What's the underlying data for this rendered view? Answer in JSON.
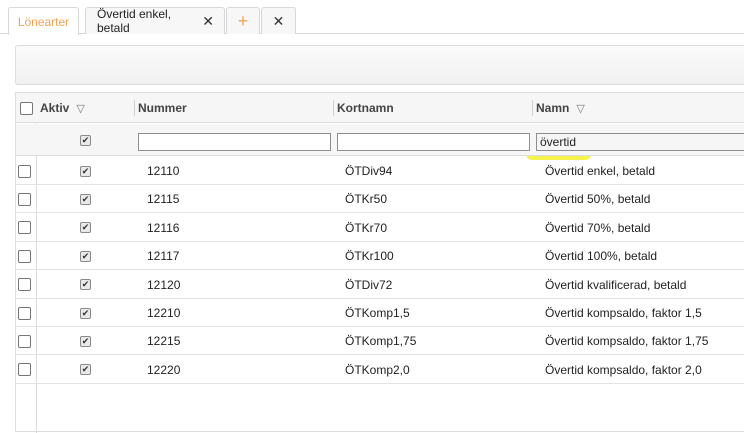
{
  "tabs": [
    {
      "label": "Lönearter",
      "active": true
    },
    {
      "label": "Övertid enkel, betald",
      "active": false
    }
  ],
  "tab_add_symbol": "+",
  "tab_close_symbol": "✕",
  "colors": {
    "accent": "#f0a45a",
    "highlight": "#f6f23a"
  },
  "grid": {
    "columns": [
      {
        "key": "aktiv",
        "label": "Aktiv",
        "filterable": true
      },
      {
        "key": "nummer",
        "label": "Nummer",
        "filterable": false
      },
      {
        "key": "kortnamn",
        "label": "Kortnamn",
        "filterable": false
      },
      {
        "key": "namn",
        "label": "Namn",
        "filterable": true
      }
    ],
    "filters": {
      "aktiv_checked": true,
      "nummer": "",
      "kortnamn": "",
      "namn": "övertid"
    },
    "rows": [
      {
        "aktiv": true,
        "nummer": "12110",
        "kortnamn": "ÖTDiv94",
        "namn": "Övertid enkel, betald"
      },
      {
        "aktiv": true,
        "nummer": "12115",
        "kortnamn": "ÖTKr50",
        "namn": "Övertid 50%, betald"
      },
      {
        "aktiv": true,
        "nummer": "12116",
        "kortnamn": "ÖTKr70",
        "namn": "Övertid 70%, betald"
      },
      {
        "aktiv": true,
        "nummer": "12117",
        "kortnamn": "ÖTKr100",
        "namn": "Övertid 100%, betald"
      },
      {
        "aktiv": true,
        "nummer": "12120",
        "kortnamn": "ÖTDiv72",
        "namn": "Övertid kvalificerad, betald"
      },
      {
        "aktiv": true,
        "nummer": "12210",
        "kortnamn": "ÖTKomp1,5",
        "namn": "Övertid kompsaldo, faktor 1,5"
      },
      {
        "aktiv": true,
        "nummer": "12215",
        "kortnamn": "ÖTKomp1,75",
        "namn": "Övertid kompsaldo, faktor 1,75"
      },
      {
        "aktiv": true,
        "nummer": "12220",
        "kortnamn": "ÖTKomp2,0",
        "namn": "Övertid kompsaldo, faktor 2,0"
      }
    ]
  }
}
